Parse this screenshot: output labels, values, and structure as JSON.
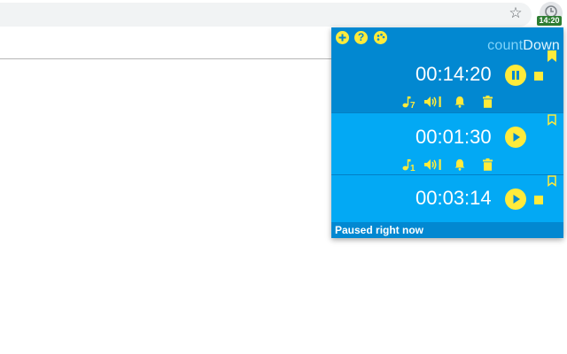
{
  "browser": {
    "star_icon": "star-outline-icon",
    "extension_icon": "countdown-extension-icon",
    "badge_text": "14:20"
  },
  "popup": {
    "header": {
      "icons": [
        "add-icon",
        "help-icon",
        "palette-icon"
      ],
      "help_glyph": "?",
      "brand_prefix": "count",
      "brand_suffix": "Down"
    },
    "timers": [
      {
        "time": "00:14:20",
        "state": "running",
        "bookmarked": true,
        "sound_number": "7",
        "has_controls": true
      },
      {
        "time": "00:01:30",
        "state": "paused",
        "bookmarked": false,
        "sound_number": "1",
        "has_controls": true
      },
      {
        "time": "00:03:14",
        "state": "paused",
        "bookmarked": false,
        "sound_number": "",
        "has_controls": false
      }
    ],
    "status_text": "Paused right now"
  },
  "colors": {
    "accent": "#ffeb3b",
    "header_blue": "#0288d1",
    "body_blue": "#03a9f4",
    "badge_green": "#2e7d32"
  }
}
